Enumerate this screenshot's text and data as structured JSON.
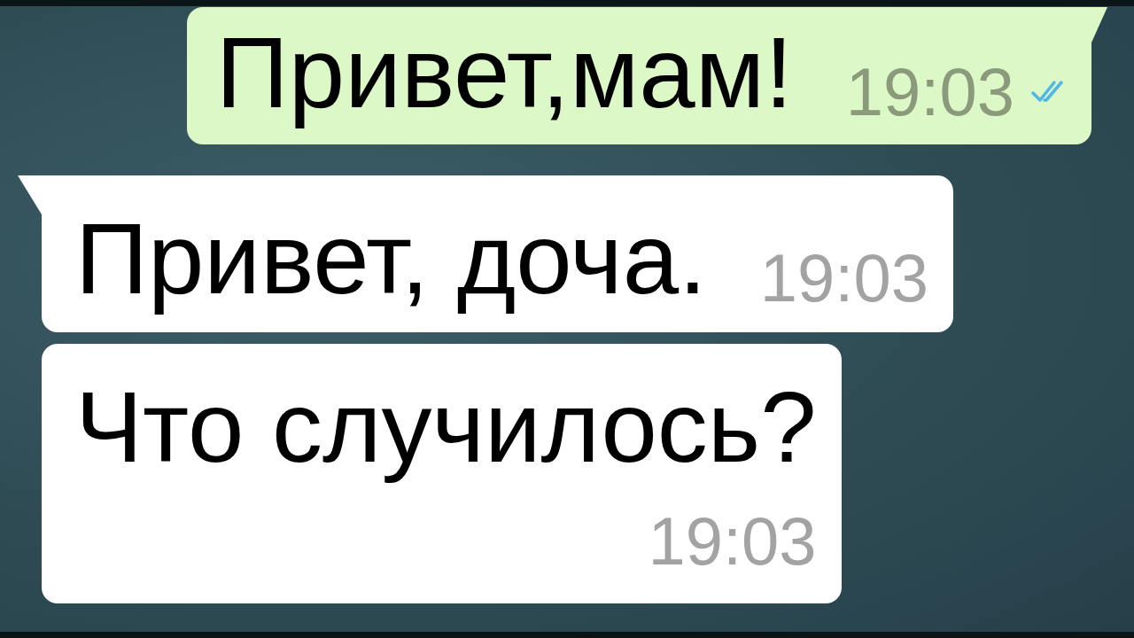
{
  "messages": [
    {
      "kind": "outgoing",
      "text": "Привет,мам!",
      "time": "19:03",
      "read": true,
      "tail": true,
      "time_below": false
    },
    {
      "kind": "incoming",
      "text": "Привет, доча.",
      "time": "19:03",
      "tail": true,
      "time_below": false
    },
    {
      "kind": "incoming",
      "text": "Что случилось?",
      "time": "19:03",
      "tail": false,
      "time_below": true
    }
  ]
}
